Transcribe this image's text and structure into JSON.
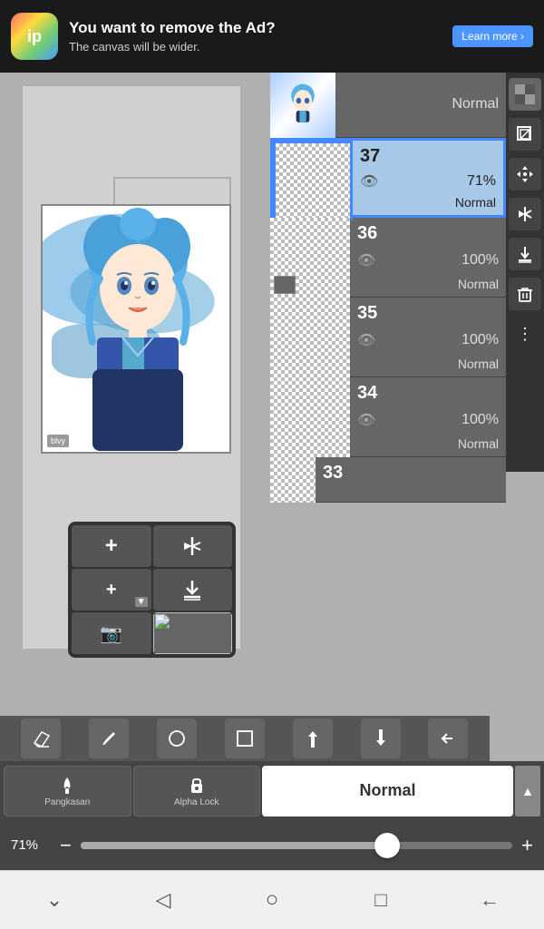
{
  "ad": {
    "icon_label": "ip",
    "title": "You want to remove the Ad?",
    "subtitle": "The canvas will be wider.",
    "button_label": "Learn more ›"
  },
  "layers": [
    {
      "id": 38,
      "number": "",
      "opacity": "",
      "mode": "Normal",
      "selected": false,
      "has_character": true
    },
    {
      "id": 37,
      "number": "37",
      "opacity": "71%",
      "mode": "Normal",
      "selected": true
    },
    {
      "id": 36,
      "number": "36",
      "opacity": "100%",
      "mode": "Normal",
      "selected": false
    },
    {
      "id": 35,
      "number": "35",
      "opacity": "100%",
      "mode": "Normal",
      "selected": false
    },
    {
      "id": 34,
      "number": "34",
      "opacity": "100%",
      "mode": "Normal",
      "selected": false
    },
    {
      "id": 33,
      "number": "33",
      "opacity": "",
      "mode": "",
      "selected": false,
      "partial": true
    }
  ],
  "action_bar": {
    "pangkasan_label": "Pangkasan",
    "alpha_lock_label": "Alpha Lock",
    "blend_mode": "Normal",
    "arrow": "▲"
  },
  "opacity_bar": {
    "value": "71%",
    "minus": "−",
    "plus": "+"
  },
  "right_toolbar": {
    "buttons": [
      "⊞",
      "⧉",
      "✛",
      "↻⧈",
      "⬇",
      "🗑",
      "⋮"
    ]
  },
  "bottom_tools": [
    {
      "icon": "+",
      "label": "add"
    },
    {
      "icon": "⊳|",
      "label": "flip"
    },
    {
      "icon": "+",
      "label": "add2"
    },
    {
      "icon": "⬇⃞",
      "label": "merge"
    },
    {
      "icon": "📷",
      "label": "camera"
    }
  ],
  "nav_buttons": [
    "⌄",
    "◁",
    "○",
    "□",
    "←"
  ]
}
